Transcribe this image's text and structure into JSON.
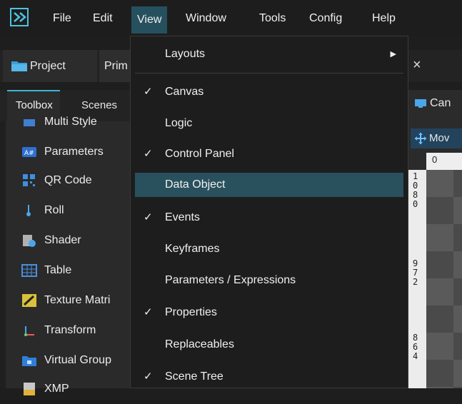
{
  "menubar": {
    "items": [
      "File",
      "Edit",
      "View",
      "Window",
      "Tools",
      "Config",
      "Help"
    ]
  },
  "tabs_top": {
    "project": "Project",
    "prim": "Prim"
  },
  "tabs_panel": {
    "toolbox": "Toolbox",
    "scenes": "Scenes"
  },
  "toolbox": {
    "items": [
      "Multi Style",
      "Parameters",
      "QR Code",
      "Roll",
      "Shader",
      "Table",
      "Texture Matri",
      "Transform",
      "Virtual Group",
      "XMP"
    ]
  },
  "right": {
    "close": "×",
    "canvas_tab": "Can",
    "move_button": "Mov",
    "ruler_top": "0",
    "ruler_left": [
      "1",
      "0",
      "8",
      "0",
      "9",
      "7",
      "2",
      "8",
      "6",
      "4"
    ]
  },
  "view_menu": {
    "items": [
      {
        "label": "Layouts",
        "checked": false,
        "submenu": true
      },
      {
        "label": "Canvas",
        "checked": true
      },
      {
        "label": "Logic",
        "checked": false
      },
      {
        "label": "Control Panel",
        "checked": true
      },
      {
        "label": "Data Object",
        "checked": false,
        "highlighted": true
      },
      {
        "label": "Events",
        "checked": true
      },
      {
        "label": "Keyframes",
        "checked": false
      },
      {
        "label": "Parameters / Expressions",
        "checked": false
      },
      {
        "label": "Properties",
        "checked": true
      },
      {
        "label": "Replaceables",
        "checked": false
      },
      {
        "label": "Scene Tree",
        "checked": true
      }
    ],
    "check_glyph": "✓",
    "submenu_glyph": "▶"
  },
  "colors": {
    "accent": "#29505d",
    "tab_accent": "#3fb6d8",
    "background": "#1e1e1e"
  }
}
